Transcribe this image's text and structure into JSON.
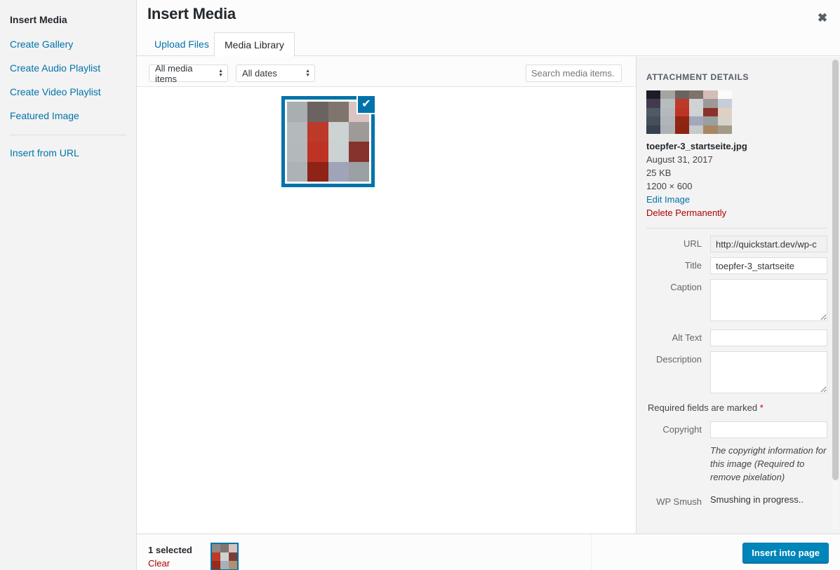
{
  "sidebar": {
    "title": "Insert Media",
    "items": [
      {
        "label": "Create Gallery"
      },
      {
        "label": "Create Audio Playlist"
      },
      {
        "label": "Create Video Playlist"
      },
      {
        "label": "Featured Image"
      }
    ],
    "footer_items": [
      {
        "label": "Insert from URL"
      }
    ]
  },
  "modal": {
    "title": "Insert Media",
    "close_icon": "close-icon"
  },
  "tabs": [
    {
      "label": "Upload Files",
      "active": false
    },
    {
      "label": "Media Library",
      "active": true
    }
  ],
  "toolbar": {
    "media_filter": "All media items",
    "date_filter": "All dates",
    "search_placeholder": "Search media items.",
    "search_value": ""
  },
  "grid": {
    "items": [
      {
        "selected": true,
        "check_icon": "checkmark-icon"
      }
    ]
  },
  "details": {
    "heading": "ATTACHMENT DETAILS",
    "filename": "toepfer-3_startseite.jpg",
    "date": "August 31, 2017",
    "filesize": "25 KB",
    "dimensions": "1200 × 600",
    "edit_link": "Edit Image",
    "delete_link": "Delete Permanently",
    "fields": {
      "url_label": "URL",
      "url_value": "http://quickstart.dev/wp-c",
      "title_label": "Title",
      "title_value": "toepfer-3_startseite",
      "caption_label": "Caption",
      "caption_value": "",
      "alt_label": "Alt Text",
      "alt_value": "",
      "description_label": "Description",
      "description_value": ""
    },
    "required_note": "Required fields are marked ",
    "required_star": "*",
    "copyright_label": "Copyright",
    "copyright_value": "",
    "copyright_help": "The copyright information for this image (Required to remove pixelation)",
    "smush_label": "WP Smush",
    "smush_status": "Smushing in progress.."
  },
  "bottom": {
    "selected_count": "1 selected",
    "clear_label": "Clear",
    "insert_label": "Insert into page"
  },
  "colors": {
    "accent": "#0073aa",
    "button": "#0085ba",
    "danger": "#a00",
    "sidebar_bg": "#f3f3f3",
    "panel_bg": "#f3f3f3"
  },
  "thumbnail_pixels": {
    "grid_4x4": [
      "#a9aeb0",
      "#6b6361",
      "#80756e",
      "#d9c4c2",
      "#b4b9bc",
      "#bd3a2a",
      "#cdd2d2",
      "#9e9a98",
      "#b3b8bb",
      "#bf3325",
      "#ccd1d1",
      "#85332c",
      "#adb2b6",
      "#8e2316",
      "#a0a4b8",
      "#9aa0a3"
    ],
    "grid_6x5": [
      "#201c26",
      "#a4a5a1",
      "#6a6361",
      "#7d736c",
      "#d4bdb9",
      "#fdfbfa",
      "#443a50",
      "#b7bcbf",
      "#bd3a2a",
      "#cfd3d3",
      "#9d9996",
      "#c8cdd8",
      "#4e5a66",
      "#b4b9bd",
      "#bd3325",
      "#cfd3d3",
      "#8a332c",
      "#e0d0c1",
      "#464f59",
      "#b0b5b9",
      "#92250f",
      "#a2a7ba",
      "#9a9fa2",
      "#d8d3c9",
      "#36414e",
      "#adb2b6",
      "#8f2312",
      "#c5cacb",
      "#a88763",
      "#a39a88"
    ],
    "grid_3x3": [
      "#8d8885",
      "#80756e",
      "#d6c3c0",
      "#bd3a2a",
      "#cdd2d2",
      "#7e3d34",
      "#9b2a18",
      "#a9aebb",
      "#b09070"
    ]
  }
}
